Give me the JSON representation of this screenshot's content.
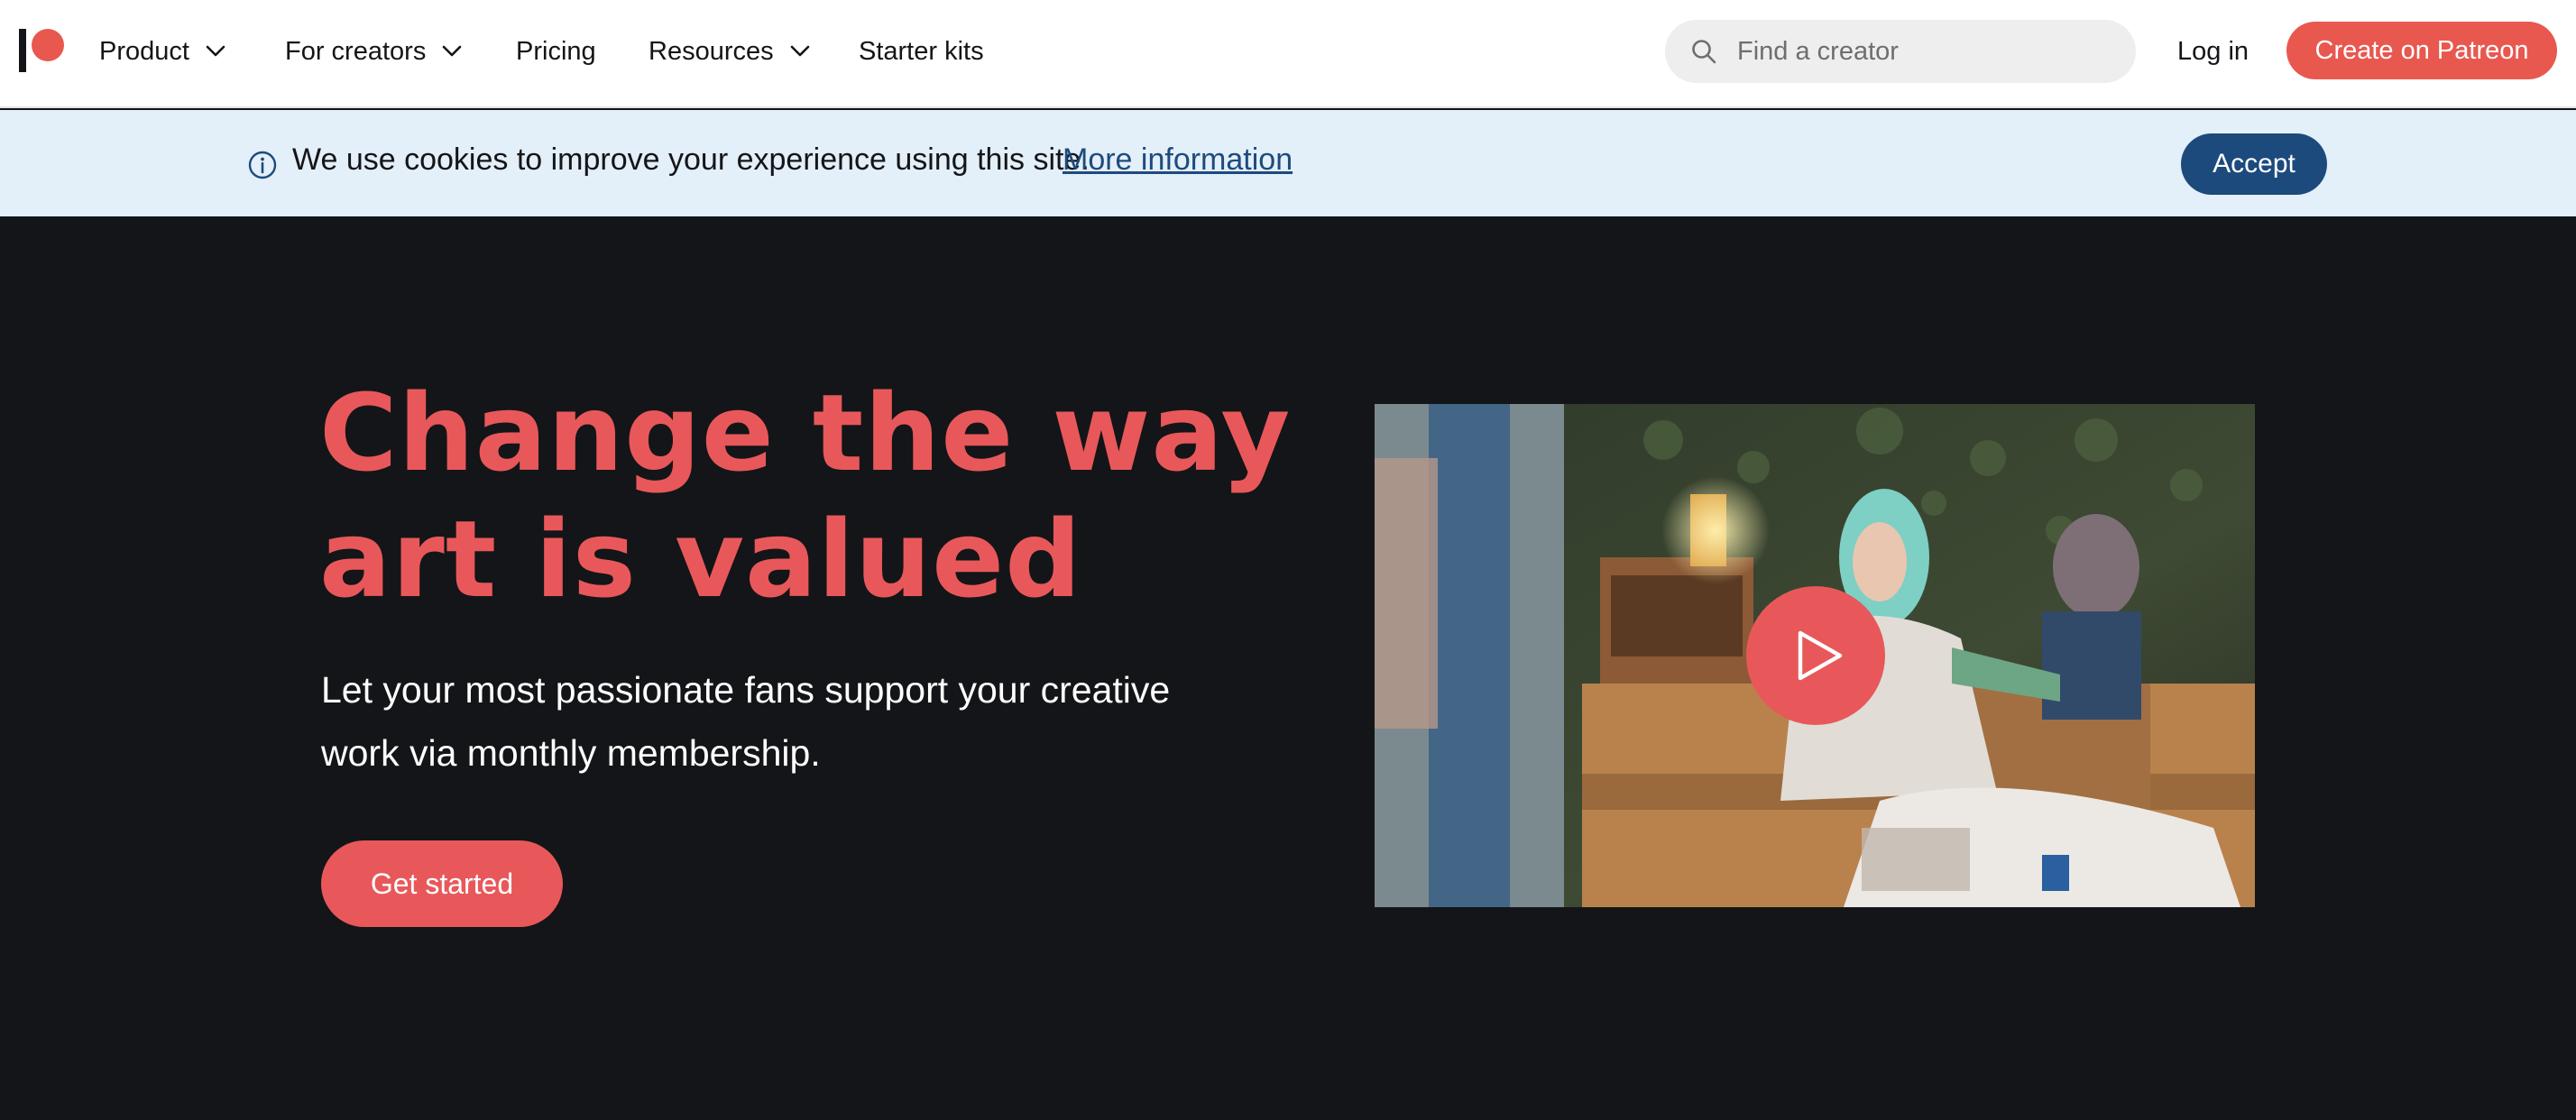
{
  "nav": {
    "logo": "patreon-logo",
    "items": [
      {
        "label": "Product",
        "has_dropdown": true
      },
      {
        "label": "For creators",
        "has_dropdown": true
      },
      {
        "label": "Pricing",
        "has_dropdown": false
      },
      {
        "label": "Resources",
        "has_dropdown": true
      },
      {
        "label": "Starter kits",
        "has_dropdown": false
      }
    ],
    "search": {
      "placeholder": "Find a creator",
      "value": "",
      "icon": "search-icon"
    },
    "login_label": "Log in",
    "create_label": "Create on Patreon"
  },
  "cookie_banner": {
    "icon": "info-icon",
    "text": "We use cookies to improve your experience using this site.",
    "link_label": "More information",
    "accept_label": "Accept"
  },
  "hero": {
    "title_lines": [
      "Change the way",
      "art is valued"
    ],
    "subtitle_lines": [
      "Let your most passionate fans support your creative",
      "work via monthly membership."
    ],
    "cta_label": "Get started"
  },
  "video": {
    "play_icon": "play-icon"
  },
  "colors": {
    "brand": "#e8584f",
    "accent_text": "#e8585a",
    "banner_bg": "#e3eff9",
    "accept_button": "#1c4a7c",
    "hero_bg": "#141518"
  }
}
